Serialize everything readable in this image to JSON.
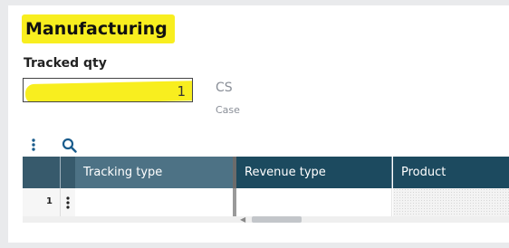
{
  "section": {
    "title": "Manufacturing"
  },
  "tracked_qty": {
    "label": "Tracked qty",
    "value": "1",
    "unit_code": "CS",
    "unit_name": "Case"
  },
  "toolbar": {
    "more_icon": "vertical-dots-icon",
    "search_icon": "search-icon"
  },
  "table": {
    "columns": [
      "Tracking type",
      "Revenue type",
      "Product"
    ],
    "rows": [
      {
        "line_number": "1"
      }
    ]
  },
  "colors": {
    "highlight": "#f8ee1f",
    "header_dark": "#1c4a5f",
    "header_active": "#4d7285",
    "header_gutter": "#375a6c",
    "accent_blue": "#1a5c8c"
  }
}
